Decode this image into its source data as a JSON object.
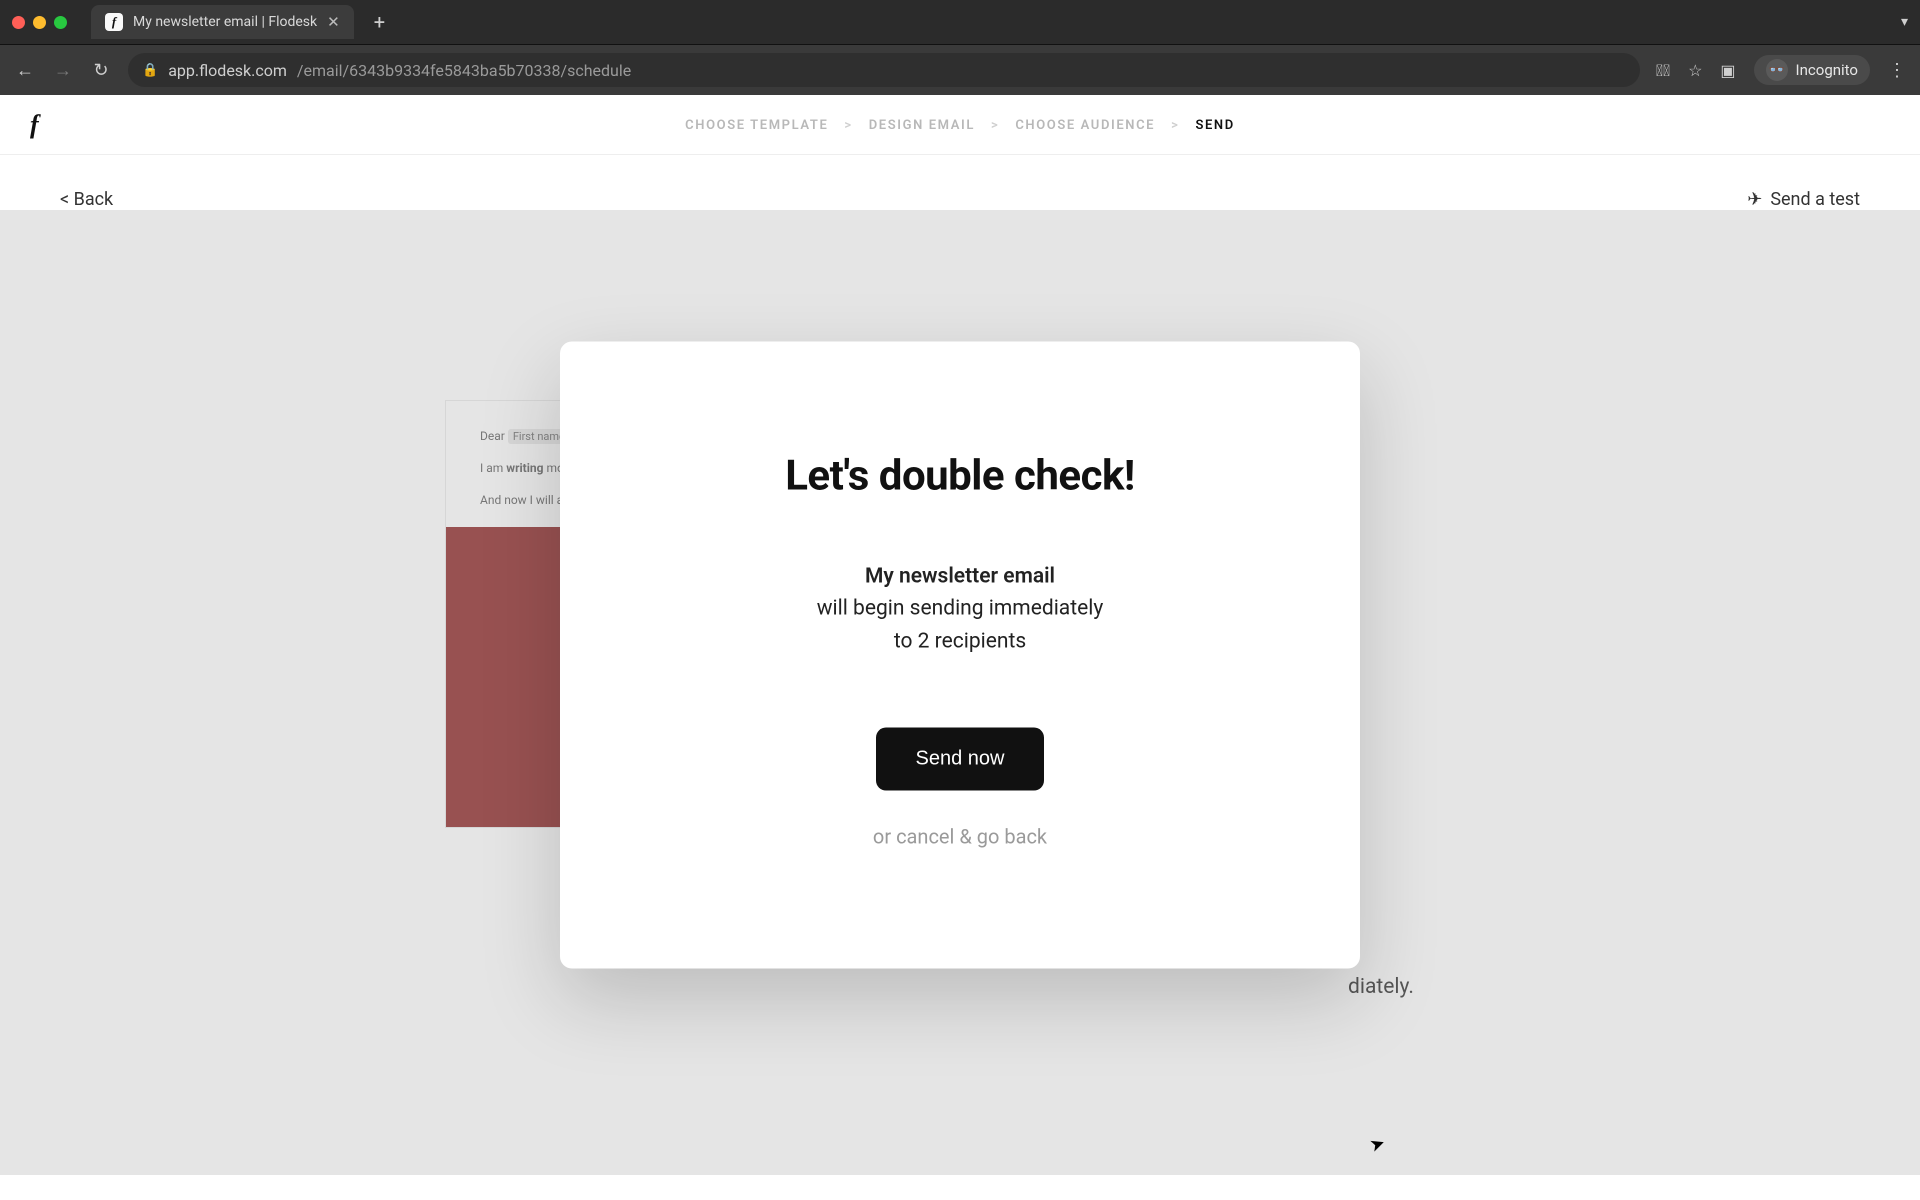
{
  "browser": {
    "tab_title": "My newsletter email | Flodesk",
    "url_host": "app.flodesk.com",
    "url_path": "/email/6343b9334fe5843ba5b70338/schedule",
    "incognito_label": "Incognito"
  },
  "app": {
    "logo_glyph": "f",
    "stepper": {
      "step1": "CHOOSE TEMPLATE",
      "step2": "DESIGN EMAIL",
      "step3": "CHOOSE AUDIENCE",
      "step4": "SEND",
      "separator": ">"
    },
    "toolbar": {
      "back_label": "< Back",
      "send_test_label": "Send a test"
    },
    "preview": {
      "greeting_prefix": "Dear",
      "greeting_field": "First name",
      "line2_prefix": "I am ",
      "line2_bold": "writing",
      "line2_suffix": " mo",
      "line3": "And now I will at"
    },
    "right_fragment": "diately."
  },
  "modal": {
    "title": "Let's double check!",
    "email_name": "My newsletter email",
    "line2": "will begin sending immediately",
    "line3": "to 2 recipients",
    "primary_label": "Send now",
    "cancel_label": "or cancel & go back"
  }
}
